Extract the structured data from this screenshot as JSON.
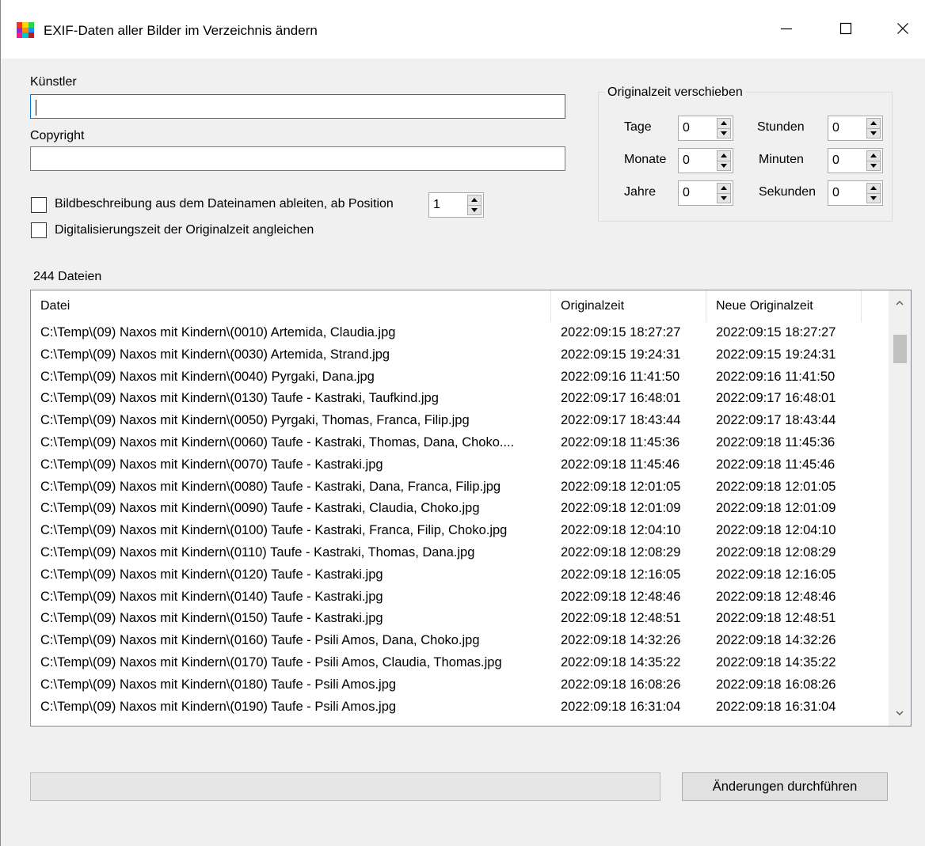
{
  "window": {
    "title": "EXIF-Daten aller Bilder im Verzeichnis ändern",
    "icon_colors": [
      "#ff2a2a",
      "#ffd400",
      "#2ad44a",
      "#8a2be2",
      "#ff8c00",
      "#1e90ff",
      "#ff1493",
      "#00c8c8",
      "#b22222"
    ]
  },
  "form": {
    "artist_label": "Künstler",
    "artist_value": "",
    "copyright_label": "Copyright",
    "copyright_value": "",
    "derive_description_label": "Bildbeschreibung aus dem Dateinamen ableiten, ab Position",
    "derive_description_checked": false,
    "position_value": "1",
    "sync_digitization_label": "Digitalisierungszeit der Originalzeit angleichen",
    "sync_digitization_checked": false
  },
  "time_shift": {
    "title": "Originalzeit verschieben",
    "tage_label": "Tage",
    "tage_value": "0",
    "monate_label": "Monate",
    "monate_value": "0",
    "jahre_label": "Jahre",
    "jahre_value": "0",
    "stunden_label": "Stunden",
    "stunden_value": "0",
    "minuten_label": "Minuten",
    "minuten_value": "0",
    "sekunden_label": "Sekunden",
    "sekunden_value": "0"
  },
  "files": {
    "count_label": "244 Dateien",
    "columns": [
      "Datei",
      "Originalzeit",
      "Neue Originalzeit"
    ],
    "rows": [
      [
        "C:\\Temp\\(09) Naxos mit Kindern\\(0010) Artemida, Claudia.jpg",
        "2022:09:15  18:27:27",
        "2022:09:15  18:27:27"
      ],
      [
        "C:\\Temp\\(09) Naxos mit Kindern\\(0030) Artemida, Strand.jpg",
        "2022:09:15  19:24:31",
        "2022:09:15  19:24:31"
      ],
      [
        "C:\\Temp\\(09) Naxos mit Kindern\\(0040) Pyrgaki, Dana.jpg",
        "2022:09:16  11:41:50",
        "2022:09:16  11:41:50"
      ],
      [
        "C:\\Temp\\(09) Naxos mit Kindern\\(0130) Taufe - Kastraki, Taufkind.jpg",
        "2022:09:17  16:48:01",
        "2022:09:17  16:48:01"
      ],
      [
        "C:\\Temp\\(09) Naxos mit Kindern\\(0050) Pyrgaki, Thomas, Franca, Filip.jpg",
        "2022:09:17  18:43:44",
        "2022:09:17  18:43:44"
      ],
      [
        "C:\\Temp\\(09) Naxos mit Kindern\\(0060) Taufe - Kastraki, Thomas, Dana, Choko....",
        "2022:09:18  11:45:36",
        "2022:09:18  11:45:36"
      ],
      [
        "C:\\Temp\\(09) Naxos mit Kindern\\(0070) Taufe - Kastraki.jpg",
        "2022:09:18  11:45:46",
        "2022:09:18  11:45:46"
      ],
      [
        "C:\\Temp\\(09) Naxos mit Kindern\\(0080) Taufe - Kastraki, Dana, Franca, Filip.jpg",
        "2022:09:18  12:01:05",
        "2022:09:18  12:01:05"
      ],
      [
        "C:\\Temp\\(09) Naxos mit Kindern\\(0090) Taufe - Kastraki, Claudia, Choko.jpg",
        "2022:09:18  12:01:09",
        "2022:09:18  12:01:09"
      ],
      [
        "C:\\Temp\\(09) Naxos mit Kindern\\(0100) Taufe - Kastraki, Franca, Filip, Choko.jpg",
        "2022:09:18  12:04:10",
        "2022:09:18  12:04:10"
      ],
      [
        "C:\\Temp\\(09) Naxos mit Kindern\\(0110) Taufe - Kastraki, Thomas, Dana.jpg",
        "2022:09:18  12:08:29",
        "2022:09:18  12:08:29"
      ],
      [
        "C:\\Temp\\(09) Naxos mit Kindern\\(0120) Taufe - Kastraki.jpg",
        "2022:09:18  12:16:05",
        "2022:09:18  12:16:05"
      ],
      [
        "C:\\Temp\\(09) Naxos mit Kindern\\(0140) Taufe - Kastraki.jpg",
        "2022:09:18  12:48:46",
        "2022:09:18  12:48:46"
      ],
      [
        "C:\\Temp\\(09) Naxos mit Kindern\\(0150) Taufe - Kastraki.jpg",
        "2022:09:18  12:48:51",
        "2022:09:18  12:48:51"
      ],
      [
        "C:\\Temp\\(09) Naxos mit Kindern\\(0160) Taufe - Psili Amos, Dana, Choko.jpg",
        "2022:09:18  14:32:26",
        "2022:09:18  14:32:26"
      ],
      [
        "C:\\Temp\\(09) Naxos mit Kindern\\(0170) Taufe - Psili Amos, Claudia, Thomas.jpg",
        "2022:09:18  14:35:22",
        "2022:09:18  14:35:22"
      ],
      [
        "C:\\Temp\\(09) Naxos mit Kindern\\(0180) Taufe - Psili Amos.jpg",
        "2022:09:18  16:08:26",
        "2022:09:18  16:08:26"
      ],
      [
        "C:\\Temp\\(09) Naxos mit Kindern\\(0190) Taufe - Psili Amos.jpg",
        "2022:09:18  16:31:04",
        "2022:09:18  16:31:04"
      ]
    ]
  },
  "progress_value": 0,
  "apply_button_label": "Änderungen durchführen"
}
